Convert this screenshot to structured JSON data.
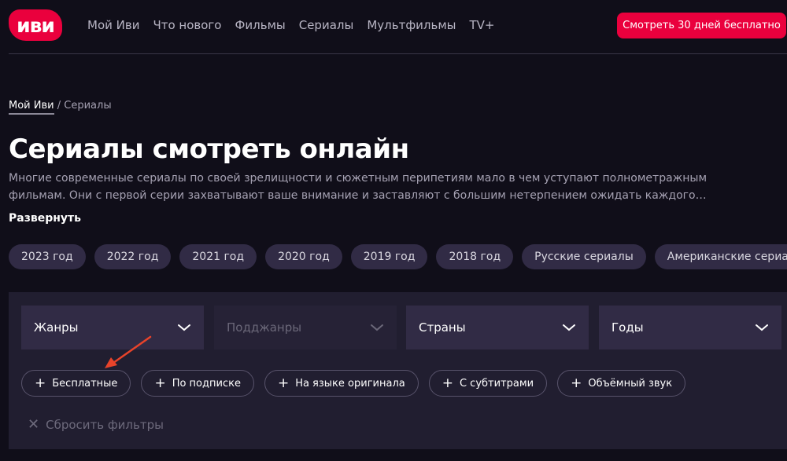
{
  "header": {
    "logo": "иви",
    "nav": [
      "Мой Иви",
      "Что нового",
      "Фильмы",
      "Сериалы",
      "Мультфильмы",
      "TV+"
    ],
    "cta": "Смотреть 30 дней бесплатно"
  },
  "breadcrumb": {
    "home": "Мой Иви",
    "separator": "/",
    "current": "Сериалы"
  },
  "page": {
    "title": "Сериалы смотреть онлайн",
    "description": "Многие современные сериалы по своей зрелищности и сюжетным перипетиям мало в чем уступают полнометражным фильмам. Они с первой серии захватывают ваше внимание и заставляют с большим нетерпением ожидать каждого…",
    "expand": "Развернуть"
  },
  "chips": [
    "2023 год",
    "2022 год",
    "2021 год",
    "2020 год",
    "2019 год",
    "2018 год",
    "Русские сериалы",
    "Американские сериалы"
  ],
  "filters": {
    "selects": [
      "Жанры",
      "Подджанры",
      "Страны",
      "Годы"
    ],
    "toggles": [
      "Бесплатные",
      "По подписке",
      "На языке оригинала",
      "С субтитрами",
      "Объёмный звук"
    ],
    "reset": "Сбросить фильтры"
  },
  "colors": {
    "accent": "#ea003d",
    "background": "#100e19",
    "panel": "#211e30",
    "annotation_arrow": "#e8432a"
  },
  "icons": {
    "toggle": "plus-icon",
    "select": "chevron-down-icon",
    "reset": "close-icon"
  }
}
